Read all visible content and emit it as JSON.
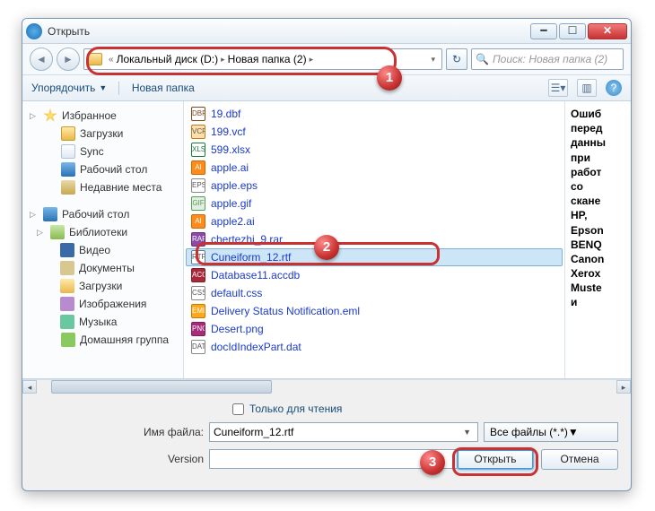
{
  "titlebar": {
    "title": "Открыть"
  },
  "nav": {
    "chev": "«",
    "crumbs": [
      "Локальный диск (D:)",
      "Новая папка (2)"
    ],
    "search_placeholder": "Поиск: Новая папка (2)"
  },
  "toolbar": {
    "organize": "Упорядочить",
    "newfolder": "Новая папка"
  },
  "sidebar": {
    "groups": [
      {
        "head": "Избранное",
        "icon": "star",
        "items": [
          {
            "label": "Загрузки",
            "icon": "folder"
          },
          {
            "label": "Sync",
            "icon": "sync"
          },
          {
            "label": "Рабочий стол",
            "icon": "desk"
          },
          {
            "label": "Недавние места",
            "icon": "recent"
          }
        ]
      },
      {
        "head": "Рабочий стол",
        "icon": "desk",
        "items": [
          {
            "label": "Библиотеки",
            "icon": "lib",
            "expandable": true,
            "sub": [
              {
                "label": "Видео",
                "icon": "vid"
              },
              {
                "label": "Документы",
                "icon": "doc"
              },
              {
                "label": "Загрузки",
                "icon": "dl"
              },
              {
                "label": "Изображения",
                "icon": "img"
              },
              {
                "label": "Музыка",
                "icon": "mus"
              }
            ]
          },
          {
            "label": "Домашняя группа",
            "icon": "home"
          }
        ]
      }
    ]
  },
  "files": [
    {
      "name": "19.dbf",
      "ext": "dbf"
    },
    {
      "name": "199.vcf",
      "ext": "vcf"
    },
    {
      "name": "599.xlsx",
      "ext": "xlsx"
    },
    {
      "name": "apple.ai",
      "ext": "ai"
    },
    {
      "name": "apple.eps",
      "ext": "eps"
    },
    {
      "name": "apple.gif",
      "ext": "gif"
    },
    {
      "name": "apple2.ai",
      "ext": "ai"
    },
    {
      "name": "chertezhi_9.rar",
      "ext": "rar"
    },
    {
      "name": "Cuneiform_12.rtf",
      "ext": "rtf",
      "selected": true
    },
    {
      "name": "Database11.accdb",
      "ext": "accdb"
    },
    {
      "name": "default.css",
      "ext": "css"
    },
    {
      "name": "Delivery Status Notification.eml",
      "ext": "eml"
    },
    {
      "name": "Desert.png",
      "ext": "png"
    },
    {
      "name": "docIdIndexPart.dat",
      "ext": "dat"
    }
  ],
  "preview": {
    "lines": [
      "Ошиб",
      "перед",
      "данны",
      "при",
      "работ",
      "со",
      "скане",
      "HP,",
      "Epson",
      "BENQ",
      "Canon",
      "Xerox",
      "Muste",
      "и"
    ]
  },
  "bottom": {
    "readonly": "Только для чтения",
    "filename_label": "Имя файла:",
    "filename_value": "Cuneiform_12.rtf",
    "filter": "Все файлы (*.*)",
    "version_label": "Version",
    "open": "Открыть",
    "cancel": "Отмена"
  },
  "callouts": {
    "1": "1",
    "2": "2",
    "3": "3"
  }
}
